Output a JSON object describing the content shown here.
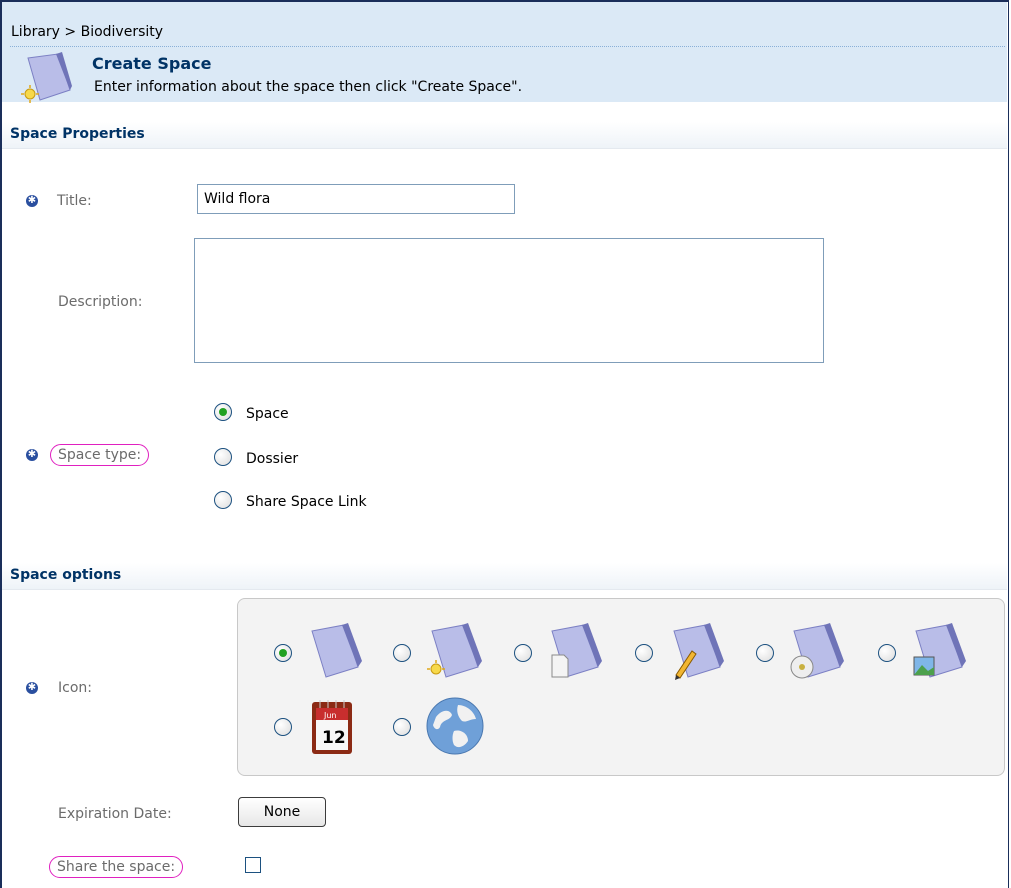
{
  "header": {
    "breadcrumb": {
      "library": "Library",
      "separator": ">",
      "current": "Biodiversity"
    },
    "icon": "create-space-icon",
    "title": "Create Space",
    "description": "Enter information about the space then click \"Create Space\"."
  },
  "space_properties": {
    "section_title": "Space Properties",
    "title_label": "Title:",
    "title_value": "Wild flora",
    "description_label": "Description:",
    "description_value": "",
    "space_type_label": "Space type:",
    "space_type_options": [
      {
        "label": "Space",
        "checked": true
      },
      {
        "label": "Dossier",
        "checked": false
      },
      {
        "label": "Share Space Link",
        "checked": false
      }
    ]
  },
  "space_options": {
    "section_title": "Space options",
    "icon_label": "Icon:",
    "icon_options": [
      {
        "icon": "folder-icon",
        "checked": true
      },
      {
        "icon": "folder-new-icon",
        "checked": false
      },
      {
        "icon": "folder-document-icon",
        "checked": false
      },
      {
        "icon": "folder-pencil-icon",
        "checked": false
      },
      {
        "icon": "folder-cd-icon",
        "checked": false
      },
      {
        "icon": "folder-image-icon",
        "checked": false
      },
      {
        "icon": "calendar-icon",
        "checked": false,
        "text_month": "Jun",
        "text_day": "12"
      },
      {
        "icon": "globe-icon",
        "checked": false
      }
    ],
    "expiration_label": "Expiration Date:",
    "expiration_button": "None",
    "share_label": "Share the space:",
    "share_checked": false
  },
  "colors": {
    "header_bg": "#dbe9f6",
    "title_blue": "#003366",
    "required_marker": "#2a4f9f",
    "highlight_circle": "#e020c0",
    "radio_checked": "#21a121"
  }
}
